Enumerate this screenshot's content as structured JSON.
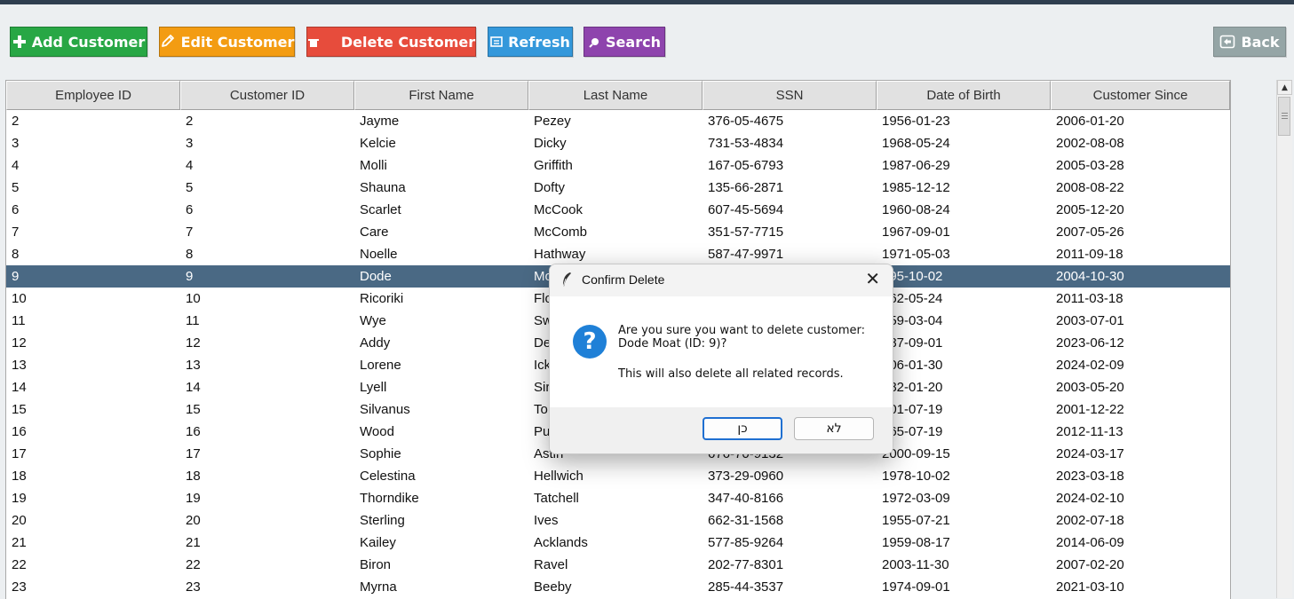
{
  "toolbar": {
    "add_label": "Add Customer",
    "edit_label": "Edit Customer",
    "delete_label": "Delete Customer",
    "refresh_label": "Refresh",
    "search_label": "Search",
    "back_label": "Back"
  },
  "table": {
    "columns": [
      "Employee ID",
      "Customer ID",
      "First Name",
      "Last Name",
      "SSN",
      "Date of Birth",
      "Customer Since"
    ],
    "selected_row_index": 7,
    "rows": [
      [
        "2",
        "2",
        "Jayme",
        "Pezey",
        "376-05-4675",
        "1956-01-23",
        "2006-01-20"
      ],
      [
        "3",
        "3",
        "Kelcie",
        "Dicky",
        "731-53-4834",
        "1968-05-24",
        "2002-08-08"
      ],
      [
        "4",
        "4",
        "Molli",
        "Griffith",
        "167-05-6793",
        "1987-06-29",
        "2005-03-28"
      ],
      [
        "5",
        "5",
        "Shauna",
        "Dofty",
        "135-66-2871",
        "1985-12-12",
        "2008-08-22"
      ],
      [
        "6",
        "6",
        "Scarlet",
        "McCook",
        "607-45-5694",
        "1960-08-24",
        "2005-12-20"
      ],
      [
        "7",
        "7",
        "Care",
        "McComb",
        "351-57-7715",
        "1967-09-01",
        "2007-05-26"
      ],
      [
        "8",
        "8",
        "Noelle",
        "Hathway",
        "587-47-9971",
        "1971-05-03",
        "2011-09-18"
      ],
      [
        "9",
        "9",
        "Dode",
        "Mo",
        "",
        "995-10-02",
        "2004-10-30"
      ],
      [
        "10",
        "10",
        "Ricoriki",
        "Flo",
        "",
        "962-05-24",
        "2011-03-18"
      ],
      [
        "11",
        "11",
        "Wye",
        "Sw",
        "",
        "959-03-04",
        "2003-07-01"
      ],
      [
        "12",
        "12",
        "Addy",
        "De",
        "",
        "987-09-01",
        "2023-06-12"
      ],
      [
        "13",
        "13",
        "Lorene",
        "Ick",
        "",
        "006-01-30",
        "2024-02-09"
      ],
      [
        "14",
        "14",
        "Lyell",
        "Sir",
        "",
        "982-01-20",
        "2003-05-20"
      ],
      [
        "15",
        "15",
        "Silvanus",
        "To",
        "",
        "001-07-19",
        "2001-12-22"
      ],
      [
        "16",
        "16",
        "Wood",
        "Pu",
        "",
        "965-07-19",
        "2012-11-13"
      ],
      [
        "17",
        "17",
        "Sophie",
        "Astin",
        "676-70-9132",
        "2000-09-15",
        "2024-03-17"
      ],
      [
        "18",
        "18",
        "Celestina",
        "Hellwich",
        "373-29-0960",
        "1978-10-02",
        "2023-03-18"
      ],
      [
        "19",
        "19",
        "Thorndike",
        "Tatchell",
        "347-40-8166",
        "1972-03-09",
        "2024-02-10"
      ],
      [
        "20",
        "20",
        "Sterling",
        "Ives",
        "662-31-1568",
        "1955-07-21",
        "2002-07-18"
      ],
      [
        "21",
        "21",
        "Kailey",
        "Acklands",
        "577-85-9264",
        "1959-08-17",
        "2014-06-09"
      ],
      [
        "22",
        "22",
        "Biron",
        "Ravel",
        "202-77-8301",
        "2003-11-30",
        "2007-02-20"
      ],
      [
        "23",
        "23",
        "Myrna",
        "Beeby",
        "285-44-3537",
        "1974-09-01",
        "2021-03-10"
      ]
    ]
  },
  "dialog": {
    "title": "Confirm Delete",
    "close_glyph": "✕",
    "icon_glyph": "?",
    "message_line1": "Are you sure you want to delete customer:",
    "message_line2": "Dode Moat (ID: 9)?",
    "message_line3": "This will also delete all related records.",
    "yes_label": "כן",
    "no_label": "לא"
  },
  "colors": {
    "add": "#28a745",
    "edit": "#f39c12",
    "delete": "#e74c3c",
    "refresh": "#3498db",
    "search": "#8e44ad",
    "back": "#95a5a6",
    "selected_row": "#4a6984"
  },
  "icons": {
    "add": "plus-icon",
    "edit": "pencil-icon",
    "delete": "trash-icon",
    "refresh": "refresh-icon",
    "search": "search-icon",
    "back": "back-icon",
    "dialog": "question-icon",
    "title": "feather-icon"
  }
}
